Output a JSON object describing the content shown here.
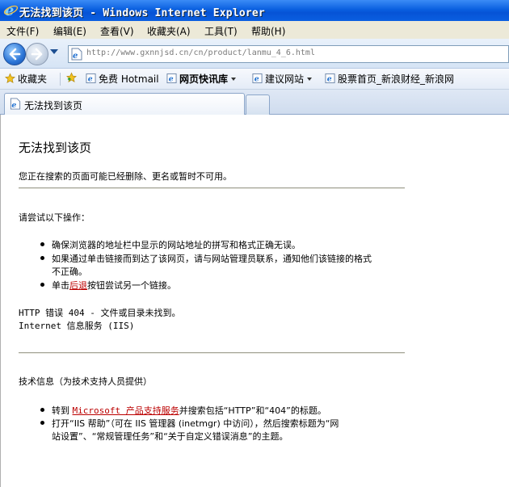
{
  "window": {
    "title": "无法找到该页 - Windows Internet Explorer"
  },
  "menu": [
    "文件(F)",
    "编辑(E)",
    "查看(V)",
    "收藏夹(A)",
    "工具(T)",
    "帮助(H)"
  ],
  "address": {
    "url": "http://www.gxnnjsd.cn/cn/product/lanmu_4_6.html"
  },
  "favorites": {
    "favorites_label": "收藏夹",
    "items": [
      "免费 Hotmail",
      "网页快讯库",
      "建议网站",
      "股票首页_新浪财经_新浪网"
    ]
  },
  "tab": {
    "label": "无法找到该页"
  },
  "page": {
    "heading": "无法找到该页",
    "intro": "您正在搜索的页面可能已经删除、更名或暂时不可用。",
    "try_heading": "请尝试以下操作：",
    "try_items": [
      "确保浏览器的地址栏中显示的网站地址的拼写和格式正确无误。",
      "如果通过单击链接而到达了该网页，请与网站管理员联系，通知他们该链接的格式",
      "不正确。"
    ],
    "back_prefix": "单击",
    "back_link": "后退",
    "back_suffix": "按钮尝试另一个链接。",
    "error_line1": "HTTP 错误 404 - 文件或目录未找到。",
    "error_line2": "Internet 信息服务 (IIS)",
    "tech_heading": "技术信息（为技术支持人员提供）",
    "tech_goto": "转到",
    "tech_link": "Microsoft 产品支持服务",
    "tech_goto_suffix": "并搜索包括“HTTP”和“404”的标题。",
    "tech_item2_line1": "打开“IIS 帮助”（可在 IIS 管理器 (inetmgr) 中访问），然后搜索标题为“网",
    "tech_item2_line2": "站设置”、“常规管理任务”和“关于自定义错误消息”的主题。"
  }
}
